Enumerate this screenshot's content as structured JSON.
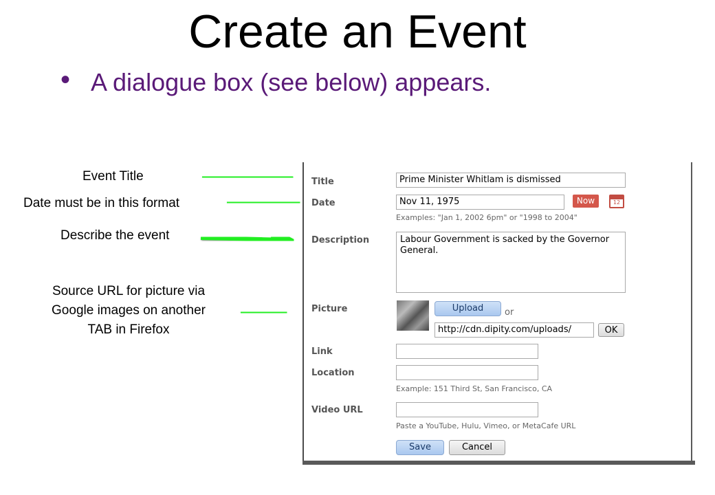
{
  "slide": {
    "title": "Create an Event",
    "bullet": "A dialogue box (see below) appears."
  },
  "annotations": {
    "event_title": "Event Title",
    "date_format": "Date must be in this format",
    "describe": "Describe the event",
    "source_line1": "Source URL for picture via",
    "source_line2": "Google images on another",
    "source_line3": "TAB in Firefox"
  },
  "form": {
    "title_label": "Title",
    "title_value": "Prime Minister Whitlam is dismissed",
    "date_label": "Date",
    "date_value": "Nov 11, 1975",
    "now_button": "Now",
    "calendar_day": "12",
    "date_hint": "Examples: \"Jan 1, 2002 6pm\" or \"1998 to 2004\"",
    "description_label": "Description",
    "description_value": "Labour Government is sacked by the Governor General.",
    "picture_label": "Picture",
    "upload_button": "Upload",
    "or_text": "or",
    "picture_url": "http://cdn.dipity.com/uploads/",
    "ok_button": "OK",
    "link_label": "Link",
    "link_value": "",
    "location_label": "Location",
    "location_value": "",
    "location_hint": "Example: 151 Third St, San Francisco, CA",
    "video_label": "Video URL",
    "video_value": "",
    "video_hint": "Paste a YouTube, Hulu, Vimeo, or MetaCafe URL",
    "save_button": "Save",
    "cancel_button": "Cancel"
  },
  "colors": {
    "bullet": "#5a1a78",
    "arrow": "#22ee22",
    "now_button": "#d4574b"
  },
  "icons": {
    "bullet": "bullet-icon",
    "arrow": "arrow-icon",
    "calendar": "calendar-icon"
  }
}
